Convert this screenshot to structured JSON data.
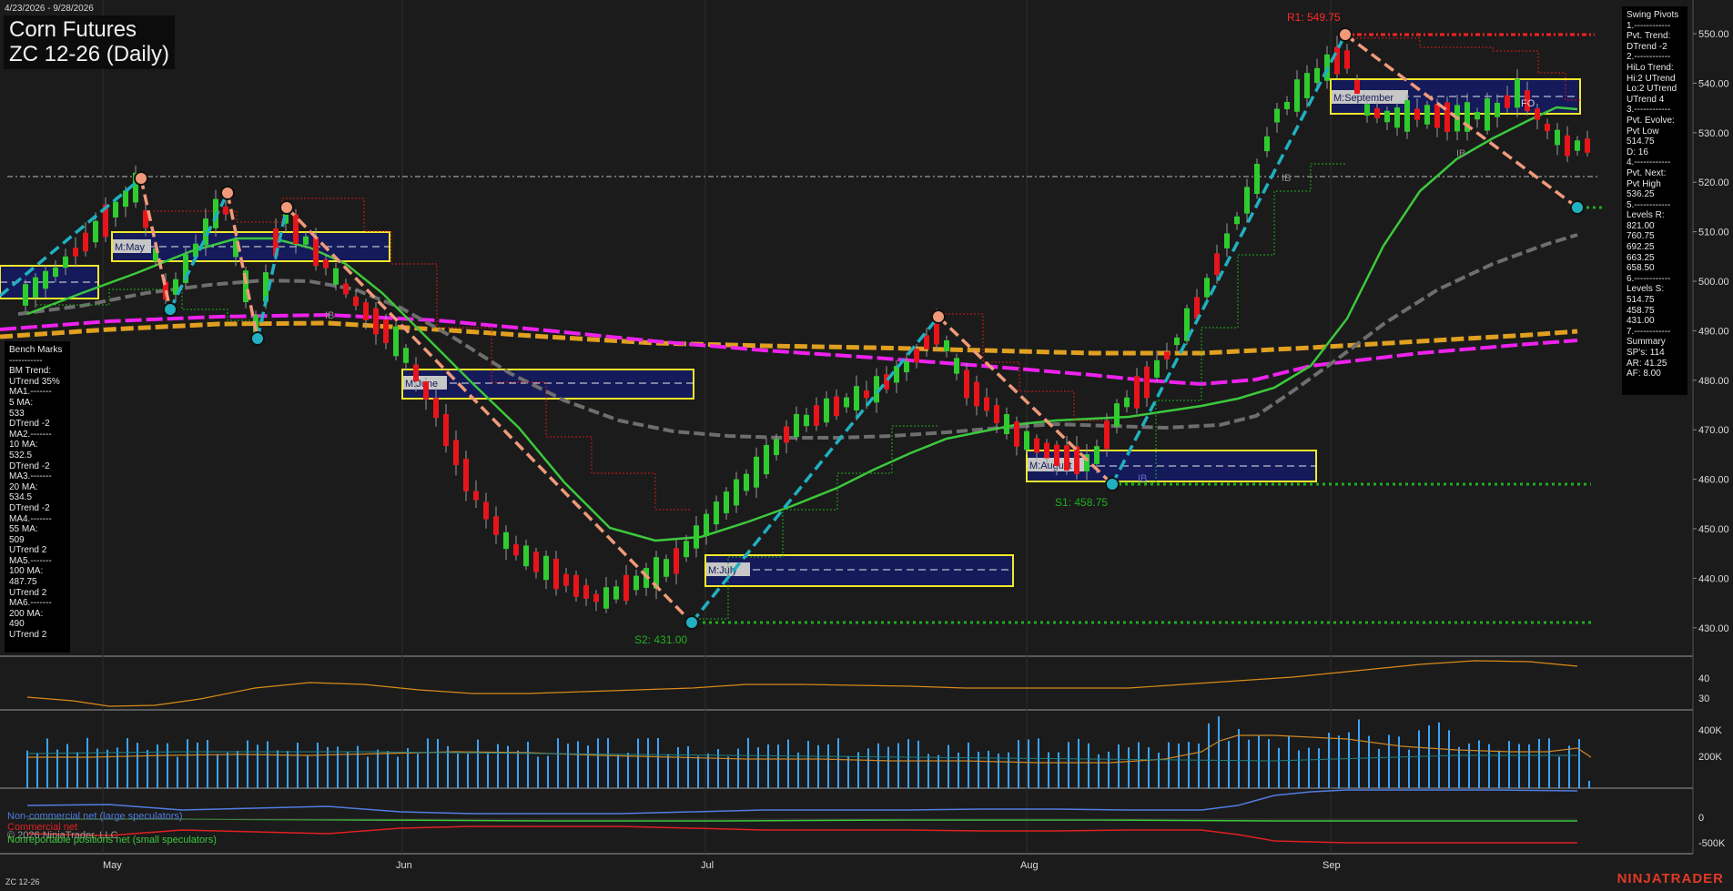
{
  "date_range": "4/23/2026 - 9/28/2026",
  "title": {
    "name": "Corn Futures",
    "contract": "ZC 12-26 (Daily)"
  },
  "price_axis": {
    "ticks": [
      "550.00",
      "540.00",
      "530.00",
      "520.00",
      "510.00",
      "500.00",
      "490.00",
      "480.00",
      "470.00",
      "460.00",
      "450.00",
      "440.00",
      "430.00"
    ]
  },
  "osc_axis": {
    "ticks": [
      "40",
      "30"
    ]
  },
  "volume_axis": {
    "ticks": [
      "400K",
      "200K"
    ]
  },
  "cot_axis": {
    "ticks": [
      "0",
      "-500K"
    ]
  },
  "time_axis": {
    "labels": [
      "May",
      "Jun",
      "Jul",
      "Aug",
      "Sep"
    ]
  },
  "pivot_labels": {
    "r1": "R1: 549.75",
    "s1": "S1: 458.75",
    "s2": "S2: 431.00"
  },
  "month_boxes": [
    "M:May",
    "M:June",
    "M:July",
    "M:August",
    "M:September"
  ],
  "markers": {
    "ib": "IB",
    "fo": "FO"
  },
  "colors": {
    "background": "#1b1b1b",
    "up_candle": "#2ecc2e",
    "down_candle": "#e8141a",
    "ma_green": "#3cc83c",
    "ma_gray": "#6e6e6e",
    "ma_orange": "#e0a020",
    "ma_magenta": "#ee22ee",
    "swing_up": "#20b0c0",
    "swing_down": "#f09a7a",
    "resistance": "#ff2222",
    "support": "#1fae1f",
    "month_box_fill": "#141a5a",
    "month_box_border": "#f2e82a",
    "volume": "#3aa4ff"
  },
  "bench_marks": [
    "Bench Marks",
    "-----------",
    "BM Trend:",
    "UTrend 35%",
    "MA1.-------",
    "5 MA:",
    "533",
    "DTrend -2",
    "MA2.-------",
    "10 MA:",
    "532.5",
    "DTrend -2",
    "MA3.-------",
    "20 MA:",
    "534.5",
    "DTrend -2",
    "MA4.-------",
    "55 MA:",
    "509",
    "UTrend 2",
    "MA5.-------",
    "100 MA:",
    "487.75",
    "UTrend 2",
    "MA6.-------",
    "200 MA:",
    "490",
    "UTrend 2"
  ],
  "swing_pivots": [
    "Swing Pivots",
    "1.------------",
    "Pvt. Trend:",
    "DTrend -2",
    "2.------------",
    "HiLo Trend:",
    "Hi:2 UTrend",
    "Lo:2 UTrend",
    "UTrend 4",
    "3.------------",
    "Pvt. Evolve:",
    "Pvt Low",
    "514.75",
    "D: 16",
    "4.------------",
    "Pvt. Next:",
    "Pvt High",
    "536.25",
    "5.------------",
    "Levels R:",
    "821.00",
    "760.75",
    "692.25",
    "663.25",
    "658.50",
    "6.------------",
    "Levels S:",
    "514.75",
    "458.75",
    "431.00",
    "7.------------",
    "Summary",
    "SP's: 114",
    "AR: 41.25",
    "AF: 8.00"
  ],
  "cot_legend": {
    "noncommercial": "Non-commercial net (large speculators)",
    "commercial": "Commercial net",
    "copyright": "© 2026 NinjaTrader, LLC",
    "nonreportable": "Nonreportable positions net (small speculators)"
  },
  "footer": {
    "symbol": "ZC 12-26",
    "brand": "NINJATRADER"
  }
}
